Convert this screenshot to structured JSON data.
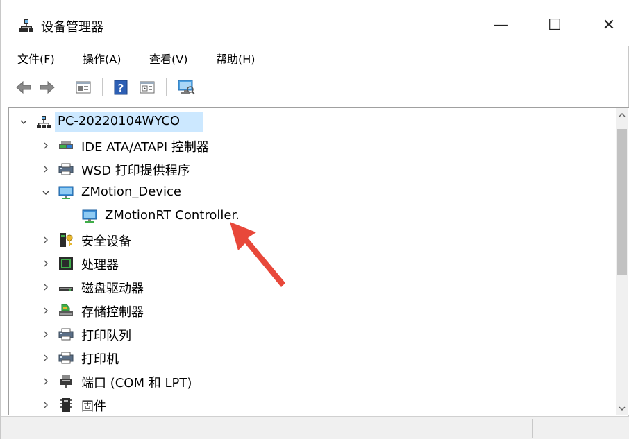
{
  "window": {
    "title": "设备管理器",
    "controls": {
      "minimize": "—",
      "maximize": "☐",
      "close": "✕"
    }
  },
  "menu": [
    "文件(F)",
    "操作(A)",
    "查看(V)",
    "帮助(H)"
  ],
  "toolbar": {
    "buttons": [
      "back-arrow-icon",
      "forward-arrow-icon",
      "properties-icon",
      "help-icon",
      "action-pane-icon",
      "monitor-icon"
    ]
  },
  "tree": {
    "root": {
      "label": "PC-20220104WYCO",
      "expanded": true,
      "selected": true
    },
    "items": [
      {
        "label": "IDE ATA/ATAPI 控制器",
        "expanded": false,
        "icon": "ide-controller-icon"
      },
      {
        "label": "WSD 打印提供程序",
        "expanded": false,
        "icon": "printer-icon"
      },
      {
        "label": "ZMotion_Device",
        "expanded": true,
        "icon": "network-monitor-icon"
      },
      {
        "label": "ZMotionRT Controller.",
        "child": true,
        "icon": "network-monitor-icon"
      },
      {
        "label": "安全设备",
        "expanded": false,
        "icon": "security-device-icon"
      },
      {
        "label": "处理器",
        "expanded": false,
        "icon": "processor-icon"
      },
      {
        "label": "磁盘驱动器",
        "expanded": false,
        "icon": "disk-drive-icon"
      },
      {
        "label": "存储控制器",
        "expanded": false,
        "icon": "storage-controller-icon"
      },
      {
        "label": "打印队列",
        "expanded": false,
        "icon": "print-queue-icon"
      },
      {
        "label": "打印机",
        "expanded": false,
        "icon": "printer-icon"
      },
      {
        "label": "端口 (COM 和 LPT)",
        "expanded": false,
        "icon": "port-icon"
      },
      {
        "label": "固件",
        "expanded": false,
        "icon": "firmware-icon"
      }
    ]
  },
  "colors": {
    "selection": "#cce8ff",
    "annotation_arrow": "#e8483a"
  }
}
